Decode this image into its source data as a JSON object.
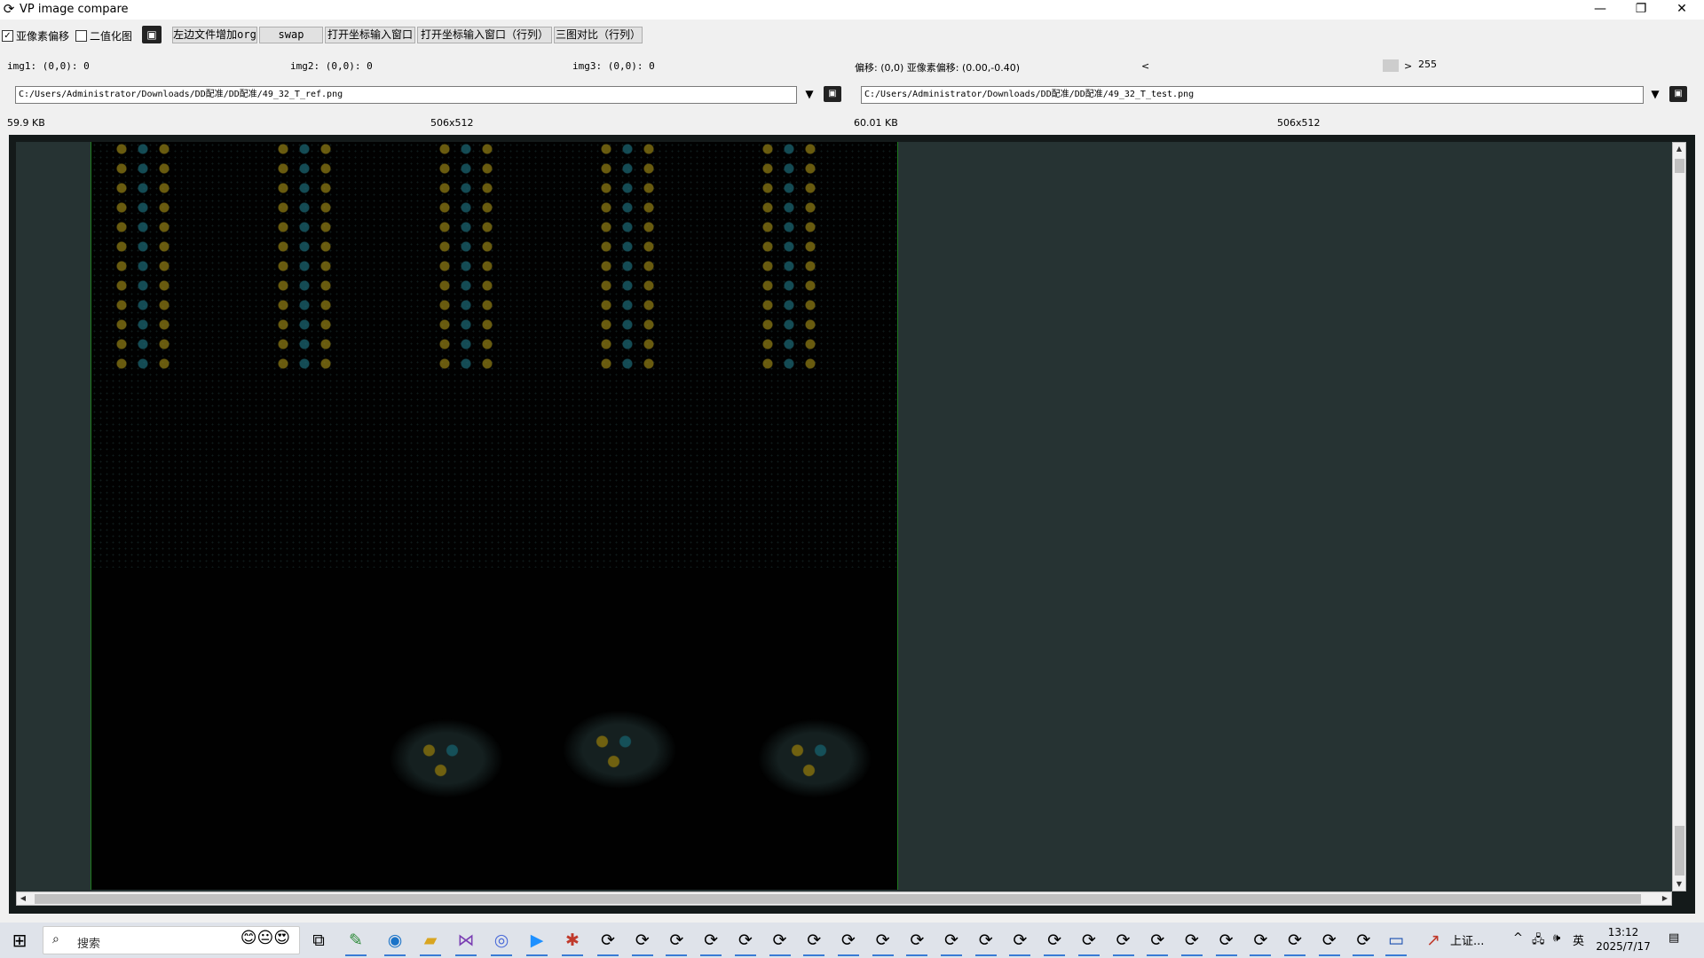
{
  "window": {
    "title": "VP image compare",
    "app_icon": "refresh-arrows-icon",
    "controls": {
      "minimize": "—",
      "restore": "❐",
      "close": "✕"
    }
  },
  "toolbar": {
    "subpixel_checkbox": {
      "label": "亚像素偏移",
      "checked": true,
      "mark": "✓"
    },
    "binarize_checkbox": {
      "label": "二值化图",
      "checked": false,
      "mark": ""
    },
    "folder_icon": "folder-open-icon",
    "buttons": [
      "左边文件增加org",
      "swap",
      "打开坐标输入窗口",
      "打开坐标输入窗口（行列）",
      "三图对比（行列）"
    ]
  },
  "info": {
    "img1": "img1: (0,0): 0",
    "img2": "img2: (0,0): 0",
    "img3": "img3: (0,0): 0",
    "offset": "偏移: (0,0) 亚像素偏移: (0.00,-0.40)",
    "slider_left": "<",
    "slider_right": ">",
    "slider_value": "255",
    "slider_level": 1.0
  },
  "files": {
    "left_path": "C:/Users/Administrator/Downloads/DD配准/DD配准/49_32_T_ref.png",
    "right_path": "C:/Users/Administrator/Downloads/DD配准/DD配准/49_32_T_test.png",
    "left_size": "59.9 KB",
    "left_dims": "506x512",
    "right_size": "60.01 KB",
    "right_dims": "506x512"
  },
  "colors": {
    "viewer_bg": "#263333",
    "image_border": "#1e7a1e",
    "feature_yellow": "#8c7a14",
    "feature_teal": "#1b6470"
  },
  "taskbar": {
    "start_icon": "windows-start-icon",
    "search_placeholder": "搜索",
    "search_icon": "search-icon",
    "icons": [
      "task-view-icon",
      "notepad-icon",
      "edge-icon",
      "file-explorer-icon",
      "visual-studio-icon",
      "browser-icon",
      "media-app-icon",
      "puzzle-app-icon"
    ],
    "app_instances": 23,
    "stock_label": "上证...",
    "tray": {
      "chevron": "^",
      "network": "network-icon",
      "volume": "volume-icon",
      "ime": "英"
    },
    "time": "13:12",
    "date": "2025/7/17",
    "notification_icon": "notification-icon"
  }
}
